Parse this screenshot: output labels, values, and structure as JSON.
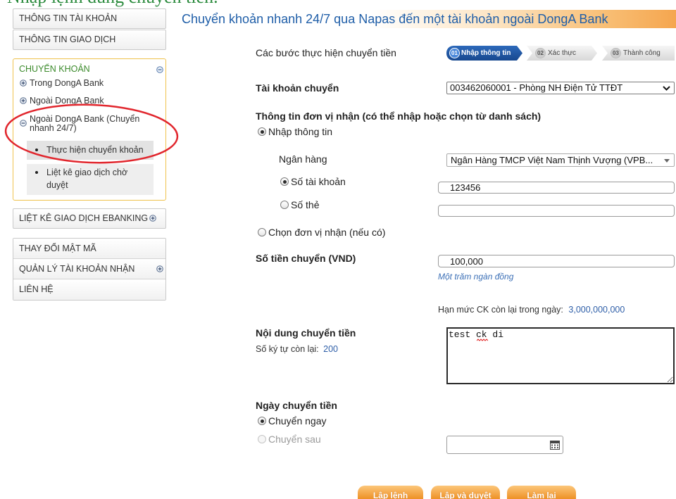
{
  "caption": "Nhập lệnh đúng chuyển tiền.",
  "colors": {
    "brand_blue": "#1f5ea8",
    "active_green": "#3b8a2b",
    "accent_orange": "#f29a2e",
    "annotation_red": "#e1262d"
  },
  "sidebar": {
    "account_info": "THÔNG TIN TÀI KHOẢN",
    "transaction_info": "THÔNG TIN GIAO DỊCH",
    "transfer": {
      "title": "CHUYỂN KHOẢN",
      "title_icon": "minus-circle-icon",
      "items": [
        {
          "label": "Trong DongA Bank",
          "icon": "plus-circle-icon"
        },
        {
          "label": "Ngoài DongA Bank",
          "icon": "plus-circle-icon"
        },
        {
          "label": "Ngoài DongA Bank (Chuyển nhanh 24/7)",
          "icon": "minus-circle-icon"
        }
      ],
      "subitems": [
        {
          "label": "Thực hiện chuyển khoản",
          "active": true
        },
        {
          "label": "Liệt kê giao dịch chờ duyệt",
          "active": false
        }
      ]
    },
    "ebanking_history": "LIỆT KÊ GIAO DỊCH EBANKING",
    "change_password": "THAY ĐỔI MẬT MÃ",
    "manage_recipients": "QUẢN LÝ TÀI KHOẢN NHẬN",
    "contact": "LIÊN HỆ"
  },
  "main": {
    "title": "Chuyển khoản nhanh 24/7 qua Napas đến một tài khoản ngoài DongA Bank",
    "steps_label": "Các bước thực hiện chuyển tiền",
    "steps": [
      {
        "number": "01",
        "label": "Nhập thông tin",
        "active": true
      },
      {
        "number": "02",
        "label": "Xác thực",
        "active": false
      },
      {
        "number": "03",
        "label": "Thành công",
        "active": false
      }
    ],
    "source_account": {
      "label": "Tài khoản chuyển",
      "value": "003462060001 - Phòng NH Điện Tử TTĐT",
      "icon": "chevron-down-icon"
    },
    "recipient": {
      "heading": "Thông tin đơn vị nhận (có thể nhập hoặc chọn từ danh sách)",
      "mode_manual": {
        "label": "Nhập thông tin",
        "checked": true
      },
      "bank_label": "Ngân hàng",
      "bank_value": "Ngân Hàng TMCP Việt Nam Thịnh Vượng (VPB...",
      "bank_icon": "caret-down-icon",
      "account_number": {
        "label": "Số tài khoản",
        "checked": true,
        "value": "123456"
      },
      "card_number": {
        "label": "Số thẻ",
        "checked": false,
        "value": ""
      },
      "mode_select": {
        "label": "Chọn đơn vị nhận (nếu có)",
        "checked": false
      }
    },
    "amount": {
      "label": "Số tiền chuyển (VND)",
      "value": "100,000",
      "in_words": "Một trăm ngàn đồng"
    },
    "limit": {
      "label": "Hạn mức CK còn lại trong ngày:",
      "value": "3,000,000,000"
    },
    "content": {
      "label": "Nội dung chuyển tiền",
      "remaining_label": "Số ký tự còn lại:",
      "remaining": "200",
      "value": "test ck di"
    },
    "date": {
      "label": "Ngày chuyển tiền",
      "now": {
        "label": "Chuyển ngay",
        "checked": true
      },
      "later": {
        "label": "Chuyển sau",
        "checked": false,
        "disabled": true
      },
      "value": "",
      "icon": "calendar-icon"
    },
    "buttons": {
      "create": "Lập lệnh",
      "create_approve": "Lập và duyệt",
      "reset": "Làm lại"
    }
  }
}
